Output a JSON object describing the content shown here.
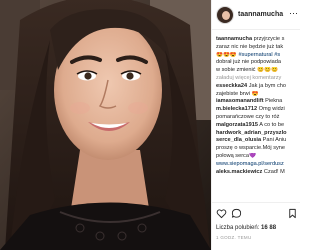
{
  "post": {
    "username": "taannamucha",
    "caption_lines": [
      "przyjrzycie s",
      "zaraz nic nie będzie już tak",
      "😍😍😍 #supernatural #s",
      "dobrał już nie podpowiada",
      "w sobie zmienić 😊😊😊"
    ],
    "caption_link_word": "nic",
    "caption_hashtags": "#supernatural #s",
    "load_more": "załaduj więcej komentarzy"
  },
  "comments": [
    {
      "user": "esseckka24",
      "lines": [
        "Jak ja bym cho",
        "zajebiste brwi 😍"
      ]
    },
    {
      "user": "iamasomanandlift",
      "lines": [
        "Piekna"
      ]
    },
    {
      "user": "m.bielecka1712",
      "lines": [
        "Omg widzi",
        "pomarańczowe czy to róż"
      ]
    },
    {
      "user": "malgorzata1915",
      "lines": [
        "A co to be"
      ]
    },
    {
      "user": "hardwork_adrian_przyszlo",
      "lines": []
    },
    {
      "user": "serce_dla_olusia",
      "lines": [
        "Pani Aniu",
        "proszę o wsparcie.Mój syne",
        "połową serca💜",
        "www.siepomaga.pl/serdusz"
      ]
    },
    {
      "user": "aleks.mackiewicz",
      "lines": [
        "Czad! M"
      ]
    }
  ],
  "likes": {
    "label": "Liczba polubień:",
    "count": "16 88"
  },
  "time_ago": "1 GODZ. TEMU"
}
